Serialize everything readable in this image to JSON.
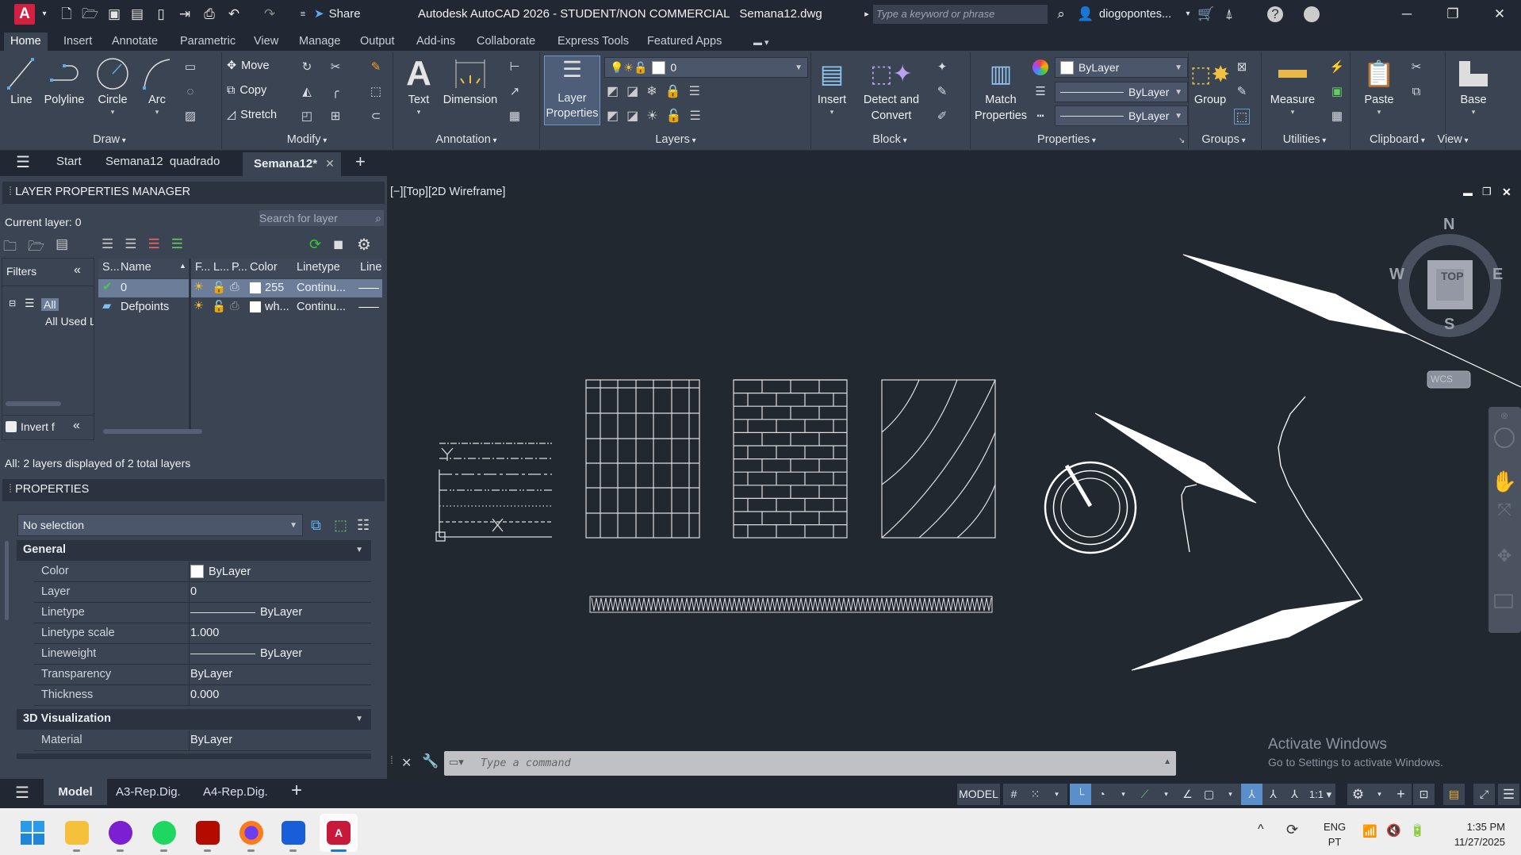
{
  "titlebar": {
    "logo": "A",
    "title": "Autodesk AutoCAD 2026 - STUDENT/NON COMMERCIAL",
    "filename": "Semana12.dwg",
    "share_label": "Share",
    "search_placeholder": "Type a keyword or phrase",
    "user": "diogopontes..."
  },
  "ribbon_tabs": [
    "Home",
    "Insert",
    "Annotate",
    "Parametric",
    "View",
    "Manage",
    "Output",
    "Add-ins",
    "Collaborate",
    "Express Tools",
    "Featured Apps"
  ],
  "ribbon": {
    "draw": {
      "label": "Draw",
      "line": "Line",
      "polyline": "Polyline",
      "circle": "Circle",
      "arc": "Arc"
    },
    "modify": {
      "label": "Modify",
      "move": "Move",
      "copy": "Copy",
      "stretch": "Stretch"
    },
    "annotation": {
      "label": "Annotation",
      "text": "Text",
      "dimension": "Dimension"
    },
    "layers": {
      "label": "Layers",
      "layer_properties_1": "Layer",
      "layer_properties_2": "Properties",
      "current_layer": "0"
    },
    "block": {
      "label": "Block",
      "insert": "Insert",
      "detect_1": "Detect and",
      "detect_2": "Convert"
    },
    "properties": {
      "label": "Properties",
      "match_1": "Match",
      "match_2": "Properties",
      "color": "ByLayer",
      "linetype": "ByLayer",
      "lineweight": "ByLayer"
    },
    "groups": {
      "label": "Groups",
      "group": "Group"
    },
    "utilities": {
      "label": "Utilities",
      "measure": "Measure"
    },
    "clipboard": {
      "label": "Clipboard",
      "paste": "Paste"
    },
    "view": {
      "label": "View",
      "base": "Base"
    }
  },
  "doc_tabs": {
    "start": "Start",
    "tab1": "Semana12  quadrado",
    "active": "Semana12*"
  },
  "layer_manager": {
    "title": "LAYER PROPERTIES MANAGER",
    "current_layer": "Current layer: 0",
    "search_placeholder": "Search for layer",
    "filters_label": "Filters",
    "tree_all": "All",
    "tree_all_used": "All Used Layers",
    "invert_label": "Invert f",
    "columns": [
      "S...",
      "Name",
      "F...",
      "L...",
      "P...",
      "Color",
      "Linetype",
      "Line"
    ],
    "rows": [
      {
        "name": "0",
        "color": "255",
        "linetype": "Continu...",
        "current": true
      },
      {
        "name": "Defpoints",
        "color": "wh...",
        "linetype": "Continu...",
        "current": false
      }
    ],
    "summary": "All: 2 layers displayed of 2 total layers"
  },
  "properties": {
    "title": "PROPERTIES",
    "selection": "No selection",
    "general_label": "General",
    "general": [
      {
        "k": "Color",
        "v": "ByLayer"
      },
      {
        "k": "Layer",
        "v": "0"
      },
      {
        "k": "Linetype",
        "v": "ByLayer"
      },
      {
        "k": "Linetype scale",
        "v": "1.000"
      },
      {
        "k": "Lineweight",
        "v": "ByLayer"
      },
      {
        "k": "Transparency",
        "v": "ByLayer"
      },
      {
        "k": "Thickness",
        "v": "0.000"
      }
    ],
    "viz_label": "3D Visualization",
    "viz": [
      {
        "k": "Material",
        "v": "ByLayer"
      }
    ]
  },
  "viewport": {
    "label": "[−][Top][2D Wireframe]",
    "cube": {
      "top": "TOP",
      "n": "N",
      "s": "S",
      "e": "E",
      "w": "W",
      "wcs": "WCS"
    }
  },
  "command": {
    "placeholder": "Type a command"
  },
  "watermark": {
    "line1": "Activate Windows",
    "line2": "Go to Settings to activate Windows."
  },
  "layout_tabs": [
    "Model",
    "A3-Rep.Dig.",
    "A4-Rep.Dig."
  ],
  "status": {
    "model": "MODEL",
    "scale": "1:1"
  },
  "tray": {
    "lang1": "ENG",
    "lang2": "PT",
    "time": "1:35 PM",
    "date": "11/27/2025"
  },
  "colors": {
    "accent": "#5b8fc9",
    "autocad_red": "#d51f3f",
    "viewport_bg": "#212830",
    "panel_bg": "#3b4453"
  }
}
